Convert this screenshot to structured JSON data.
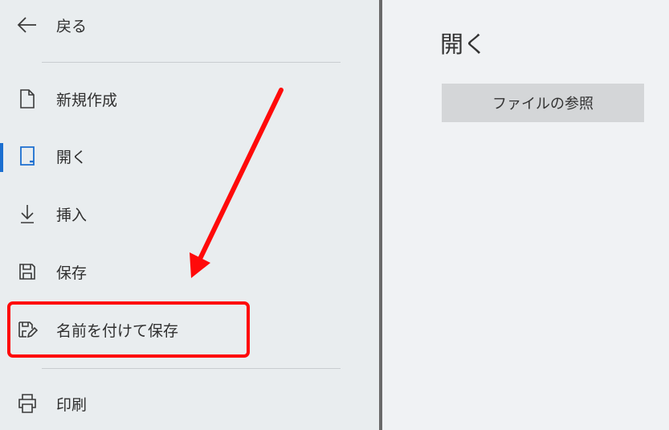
{
  "sidebar": {
    "back_label": "戻る",
    "items": [
      {
        "label": "新規作成",
        "icon": "new-document-icon"
      },
      {
        "label": "開く",
        "icon": "open-icon",
        "active": true
      },
      {
        "label": "挿入",
        "icon": "insert-icon"
      },
      {
        "label": "保存",
        "icon": "save-icon"
      },
      {
        "label": "名前を付けて保存",
        "icon": "save-as-icon",
        "highlighted": true
      },
      {
        "label": "印刷",
        "icon": "print-icon"
      }
    ]
  },
  "main": {
    "title": "開く",
    "browse_button_label": "ファイルの参照"
  },
  "colors": {
    "accent": "#1c6fd0",
    "annotation": "#ff0a0a",
    "sidebar_bg": "#e9edef",
    "main_bg": "#f0f2f4",
    "button_bg": "#d4d6d8"
  }
}
